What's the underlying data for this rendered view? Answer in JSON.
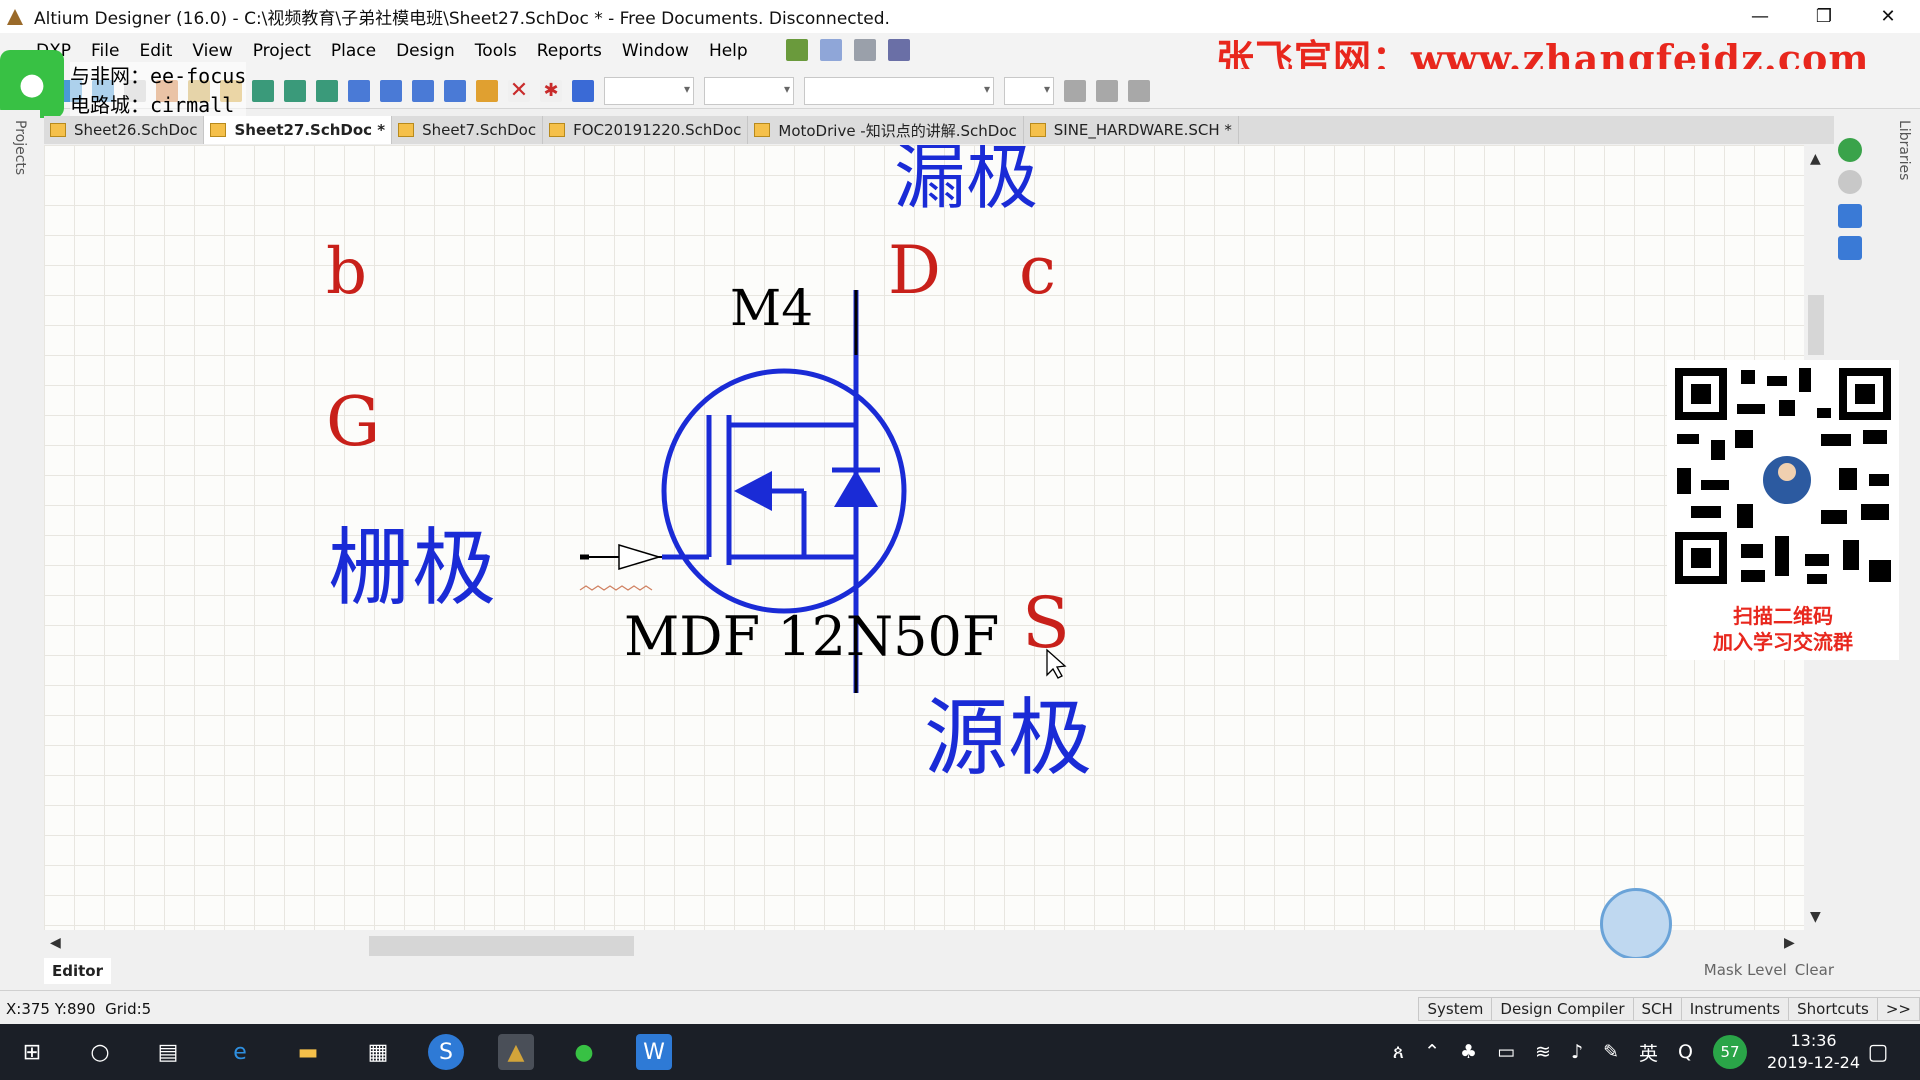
{
  "window": {
    "title": "Altium Designer (16.0) - C:\\视频教育\\子弟社模电班\\Sheet27.SchDoc * - Free Documents. Disconnected.",
    "controls": [
      "—",
      "❐",
      "✕"
    ]
  },
  "menu": {
    "items": [
      "DXP",
      "File",
      "Edit",
      "View",
      "Project",
      "Place",
      "Design",
      "Tools",
      "Reports",
      "Window",
      "Help"
    ]
  },
  "overlay": {
    "promo": "张飞官网：www.zhangfeidz.com",
    "ee_line1": "与非网：ee-focus",
    "ee_line2": "电路城：cirmall",
    "qr_caption_1": "扫描二维码",
    "qr_caption_2": "加入学习交流群"
  },
  "tabs": [
    {
      "label": "Sheet26.SchDoc",
      "active": false
    },
    {
      "label": "Sheet27.SchDoc *",
      "active": true
    },
    {
      "label": "Sheet7.SchDoc",
      "active": false
    },
    {
      "label": "FOC20191220.SchDoc",
      "active": false
    },
    {
      "label": "MotoDrive -知识点的讲解.SchDoc",
      "active": false
    },
    {
      "label": "SINE_HARDWARE.SCH *",
      "active": false
    }
  ],
  "side_panels": {
    "left": "Projects",
    "right": "Libraries"
  },
  "schematic": {
    "drain_cn": "漏极",
    "gate_cn": "栅极",
    "source_cn": "源极",
    "pin_b": "b",
    "pin_c": "c",
    "pin_G": "G",
    "pin_D": "D",
    "pin_S": "S",
    "designator": "M4",
    "part": "MDF 12N50F",
    "colors": {
      "red": "#c8201a",
      "blue": "#1a2bd6"
    }
  },
  "editor": {
    "tab": "Editor",
    "mask_level": "Mask Level",
    "clear": "Clear"
  },
  "status": {
    "coords": "X:375 Y:890",
    "grid": "Grid:5",
    "panels": [
      "System",
      "Design Compiler",
      "SCH",
      "Instruments",
      "Shortcuts",
      ">>"
    ]
  },
  "taskbar": {
    "time": "13:36",
    "date": "2019-12-24",
    "ime": "英",
    "battery": "57"
  }
}
